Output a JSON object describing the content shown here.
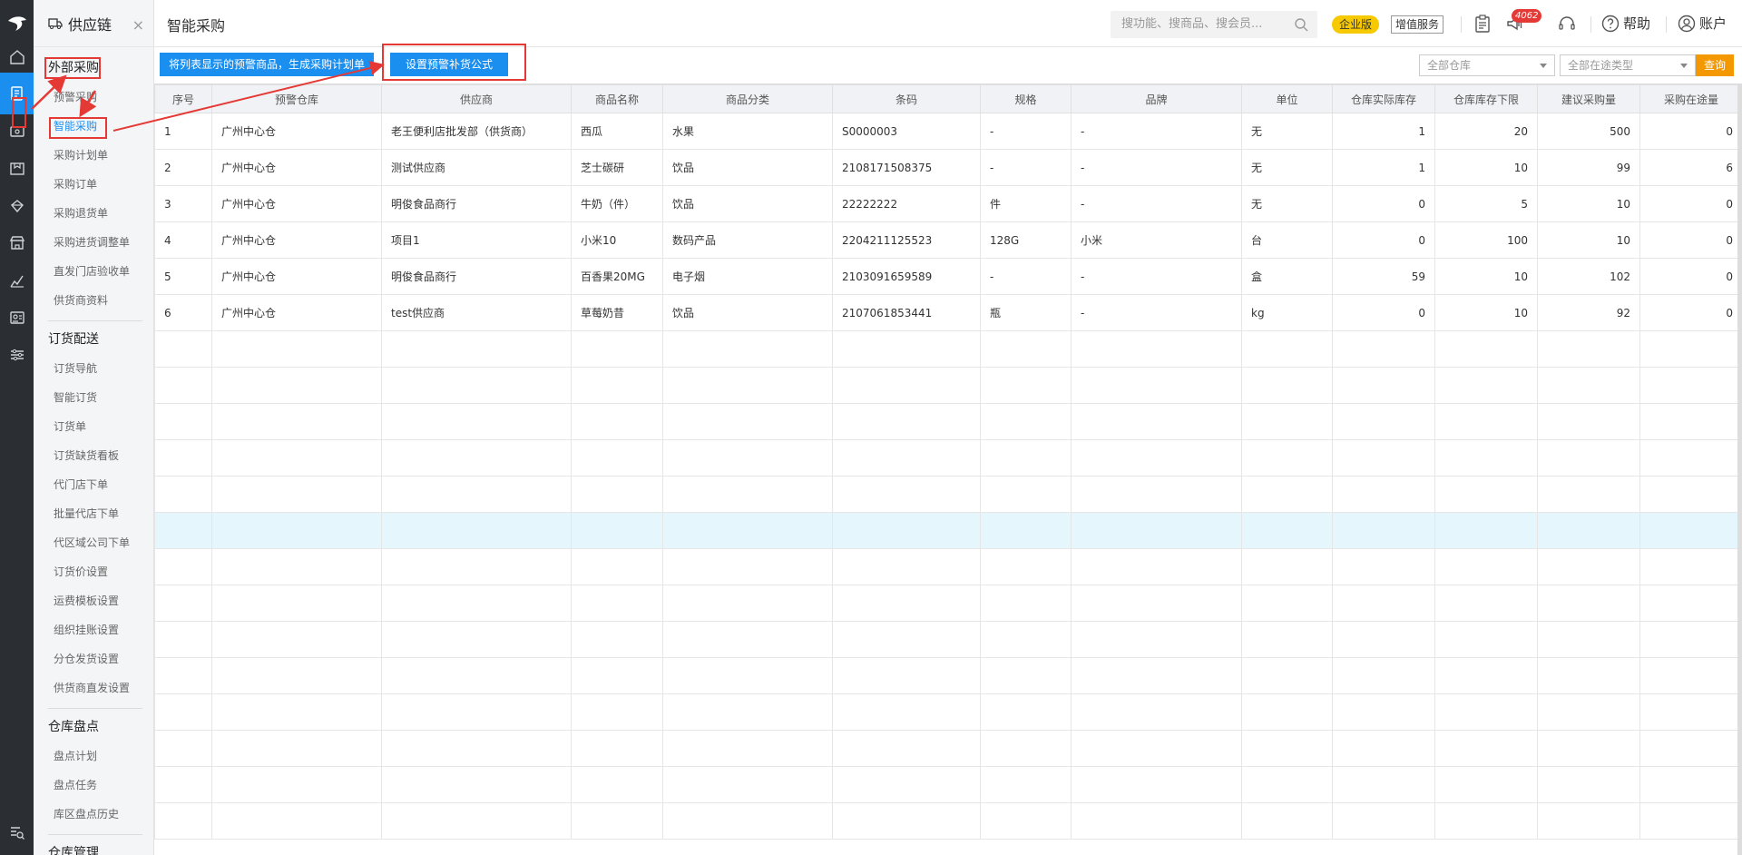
{
  "sidebar": {
    "title": "供应链",
    "close_glyph": "×",
    "groups": [
      {
        "title": "外部采购",
        "items": [
          "预警采购",
          "智能采购",
          "采购计划单",
          "采购订单",
          "采购退货单",
          "采购进货调整单",
          "直发门店验收单",
          "供货商资料"
        ]
      },
      {
        "title": "订货配送",
        "items": [
          "订货导航",
          "智能订货",
          "订货单",
          "订货缺货看板",
          "代门店下单",
          "批量代店下单",
          "代区域公司下单",
          "订货价设置",
          "运费模板设置",
          "组织挂账设置",
          "分仓发货设置",
          "供货商直发设置"
        ]
      },
      {
        "title": "仓库盘点",
        "items": [
          "盘点计划",
          "盘点任务",
          "库区盘点历史"
        ]
      },
      {
        "title": "仓库管理",
        "items": []
      }
    ]
  },
  "header": {
    "page_title": "智能采购",
    "search_placeholder": "搜功能、搜商品、搜会员...",
    "badge_enterprise": "企业版",
    "badge_vas": "增值服务",
    "notification_count": "4062",
    "help": "帮助",
    "account": "账户"
  },
  "toolbar": {
    "generate_plan_button": "将列表显示的预警商品，生成采购计划单",
    "set_formula_button": "设置预警补货公式",
    "warehouse_select": "全部仓库",
    "transit_type_select": "全部在途类型",
    "query_button": "查询"
  },
  "table": {
    "columns": [
      "序号",
      "预警仓库",
      "供应商",
      "商品名称",
      "商品分类",
      "条码",
      "规格",
      "品牌",
      "单位",
      "仓库实际库存",
      "仓库库存下限",
      "建议采购量",
      "采购在途量"
    ],
    "rows": [
      [
        "1",
        "广州中心仓",
        "老王便利店批发部（供货商）",
        "西瓜",
        "水果",
        "S0000003",
        "-",
        "-",
        "无",
        "1",
        "20",
        "500",
        "0"
      ],
      [
        "2",
        "广州中心仓",
        "测试供应商",
        "芝士碳研",
        "饮品",
        "2108171508375",
        "-",
        "-",
        "无",
        "1",
        "10",
        "99",
        "6"
      ],
      [
        "3",
        "广州中心仓",
        "明俊食品商行",
        "牛奶（件）",
        "饮品",
        "22222222",
        "件",
        "-",
        "无",
        "0",
        "5",
        "10",
        "0"
      ],
      [
        "4",
        "广州中心仓",
        "项目1",
        "小米10",
        "数码产品",
        "2204211125523",
        "128G",
        "小米",
        "台",
        "0",
        "100",
        "10",
        "0"
      ],
      [
        "5",
        "广州中心仓",
        "明俊食品商行",
        "百香果20MG",
        "电子烟",
        "2103091659589",
        "-",
        "-",
        "盒",
        "59",
        "10",
        "102",
        "0"
      ],
      [
        "6",
        "广州中心仓",
        "test供应商",
        "草莓奶昔",
        "饮品",
        "2107061853441",
        "瓶",
        "-",
        "kg",
        "0",
        "10",
        "92",
        "0"
      ]
    ]
  },
  "colors": {
    "accent": "#1a8ff0",
    "rail": "#2b2e33",
    "query": "#f39800",
    "annotation": "#e53935",
    "highlight_row": "#e6f6fd"
  },
  "icons": [
    "logo-icon",
    "home-icon",
    "supply-chain-icon",
    "cashier-icon",
    "product-icon",
    "member-icon",
    "store-icon",
    "report-icon",
    "employee-icon",
    "settings-icon",
    "search-menu-icon",
    "search-icon",
    "clipboard-icon",
    "notification-icon",
    "headset-icon",
    "help-icon",
    "account-icon",
    "truck-icon"
  ]
}
